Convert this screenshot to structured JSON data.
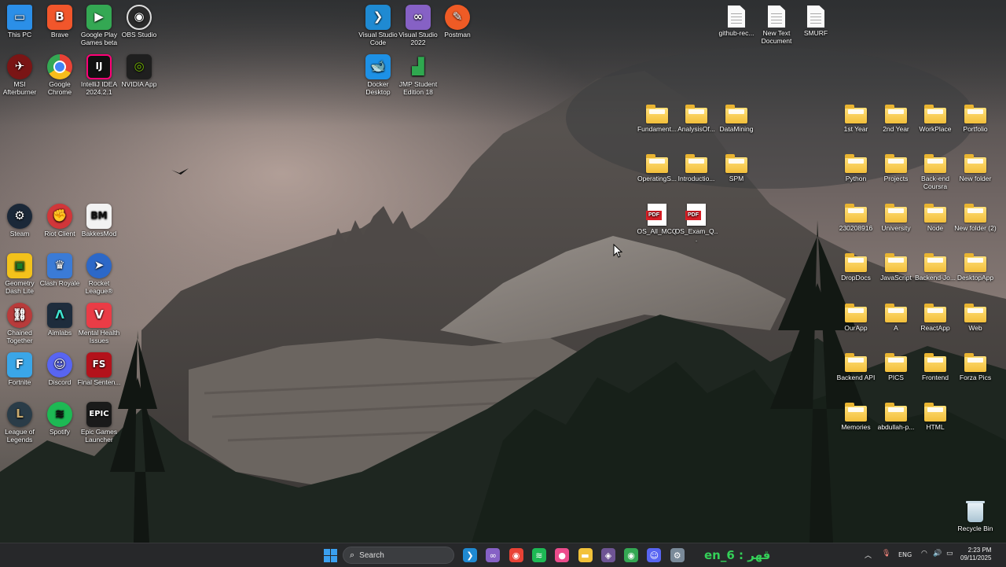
{
  "desktop": {
    "left_apps": [
      {
        "label": "This PC",
        "icon": "computer-icon",
        "color": "#2b8fe8"
      },
      {
        "label": "Brave",
        "icon": "brave-lion-icon",
        "color": "#f1562b"
      },
      {
        "label": "Google Play Games beta",
        "icon": "play-games-icon",
        "color": "#34a853"
      },
      {
        "label": "OBS Studio",
        "icon": "obs-icon",
        "color": "#2a2a2a"
      },
      {
        "label": "MSI Afterburner",
        "icon": "afterburner-icon",
        "color": "#7a1515"
      },
      {
        "label": "Google Chrome",
        "icon": "chrome-icon",
        "color": "#e94235"
      },
      {
        "label": "IntelliJ IDEA 2024.2.1",
        "icon": "intellij-icon",
        "color": "#111111"
      },
      {
        "label": "NVIDIA App",
        "icon": "nvidia-icon",
        "color": "#1f1f1f"
      },
      {
        "label": "Steam",
        "icon": "steam-icon",
        "color": "#1b2838"
      },
      {
        "label": "Riot Client",
        "icon": "riot-icon",
        "color": "#d13639"
      },
      {
        "label": "BakkesMod",
        "icon": "bakkesmod-icon",
        "color": "#f2f2f2"
      },
      {
        "label": "Geometry Dash Lite",
        "icon": "geometry-dash-icon",
        "color": "#f3c21b"
      },
      {
        "label": "Clash Royale",
        "icon": "clash-royale-icon",
        "color": "#3b7bd6"
      },
      {
        "label": "Rocket League®",
        "icon": "rocket-league-icon",
        "color": "#2c68c8"
      },
      {
        "label": "Chained Together",
        "icon": "chained-together-icon",
        "color": "#b83b3b"
      },
      {
        "label": "Aimlabs",
        "icon": "aimlabs-icon",
        "color": "#1e2c3c"
      },
      {
        "label": "Mental Health Issues",
        "icon": "valorant-icon",
        "color": "#ea3c46"
      },
      {
        "label": "Fortnite",
        "icon": "fortnite-icon",
        "color": "#3aa6e8"
      },
      {
        "label": "Discord",
        "icon": "discord-icon",
        "color": "#5865f2"
      },
      {
        "label": "Final Senten...",
        "icon": "final-sentence-icon",
        "color": "#b3121b"
      },
      {
        "label": "League of Legends",
        "icon": "league-icon",
        "color": "#2a3c48"
      },
      {
        "label": "Spotify",
        "icon": "spotify-icon",
        "color": "#1db954"
      },
      {
        "label": "Epic Games Launcher",
        "icon": "epic-games-icon",
        "color": "#1a1a1a"
      }
    ],
    "middle_apps": [
      {
        "label": "Visual Studio Code",
        "icon": "vscode-icon",
        "color": "#1f8ad2"
      },
      {
        "label": "Visual Studio 2022",
        "icon": "visual-studio-icon",
        "color": "#8661c5"
      },
      {
        "label": "Postman",
        "icon": "postman-icon",
        "color": "#ef5b25"
      },
      {
        "label": "Docker Desktop",
        "icon": "docker-icon",
        "color": "#1d91e6"
      },
      {
        "label": "JMP Student Edition 18",
        "icon": "jmp-icon",
        "color": "#2fa84f"
      }
    ],
    "top_docs": [
      {
        "label": "github-rec..."
      },
      {
        "label": "New Text Document"
      },
      {
        "label": "SMURF"
      }
    ],
    "middle_folders": [
      {
        "label": "Fundament..."
      },
      {
        "label": "AnalysisOf..."
      },
      {
        "label": "DataMining"
      },
      {
        "label": "OperatingS..."
      },
      {
        "label": "Introductio..."
      },
      {
        "label": "SPM"
      }
    ],
    "pdfs": [
      {
        "label": "OS_All_MCQ",
        "badge": "PDF"
      },
      {
        "label": "OS_Exam_Q...",
        "badge": "PDF"
      }
    ],
    "right_folders": [
      {
        "label": "1st Year"
      },
      {
        "label": "2nd Year"
      },
      {
        "label": "WorkPlace"
      },
      {
        "label": "Portfolio"
      },
      {
        "label": "Python"
      },
      {
        "label": "Projects"
      },
      {
        "label": "Back-end Coursra"
      },
      {
        "label": "New folder"
      },
      {
        "label": "230208916"
      },
      {
        "label": "University"
      },
      {
        "label": "Node"
      },
      {
        "label": "New folder (2)"
      },
      {
        "label": "DropDocs"
      },
      {
        "label": "JavaScript"
      },
      {
        "label": "Backend-Jo..."
      },
      {
        "label": "DesktopApp"
      },
      {
        "label": "OurApp"
      },
      {
        "label": "A"
      },
      {
        "label": "ReactApp"
      },
      {
        "label": "Web"
      },
      {
        "label": "Backend API"
      },
      {
        "label": "PICS"
      },
      {
        "label": "Frontend"
      },
      {
        "label": "Forza Pics"
      },
      {
        "label": "Memories"
      },
      {
        "label": "abdullah-p..."
      },
      {
        "label": "HTML"
      }
    ],
    "recycle_bin": {
      "label": "Recycle Bin"
    }
  },
  "taskbar": {
    "search_placeholder": "Search",
    "widget_text": "en_6 : قهر",
    "pinned": [
      {
        "name": "vscode-icon",
        "color": "#1f8ad2"
      },
      {
        "name": "visual-studio-icon",
        "color": "#8661c5"
      },
      {
        "name": "chrome-icon",
        "color": "#e94235"
      },
      {
        "name": "spotify-icon",
        "color": "#1db954"
      },
      {
        "name": "pink-app-icon",
        "color": "#ec4c8c"
      },
      {
        "name": "file-explorer-icon",
        "color": "#f3c23a"
      },
      {
        "name": "github-desktop-icon",
        "color": "#6e5494"
      },
      {
        "name": "chrome-profile-icon",
        "color": "#34a853"
      },
      {
        "name": "discord-icon",
        "color": "#5865f2"
      },
      {
        "name": "settings-icon",
        "color": "#7a8a99"
      }
    ],
    "tray": {
      "language": "ENG"
    },
    "clock": {
      "time": "2:23 PM",
      "date": "09/11/2025"
    }
  }
}
